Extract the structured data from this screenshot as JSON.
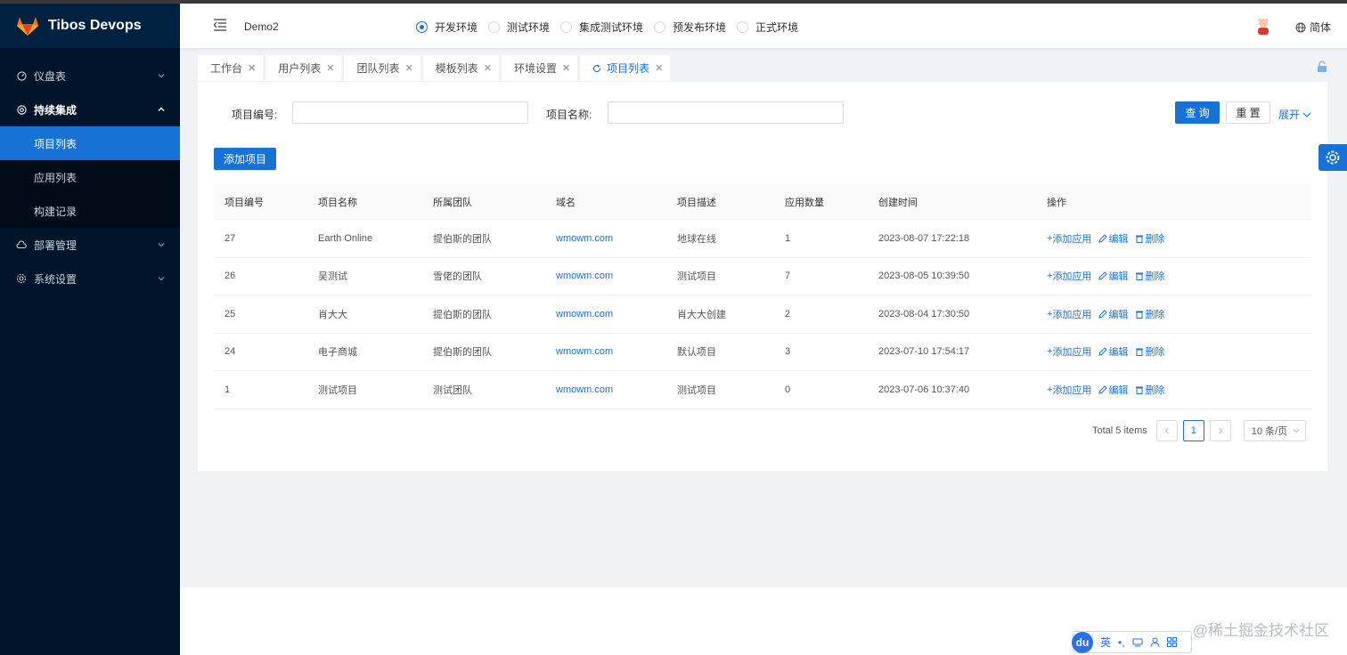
{
  "app": {
    "title": "Tibos Devops"
  },
  "colors": {
    "accent": "#1872d6",
    "sidebar_bg": "#001529"
  },
  "sidebar": {
    "items": [
      {
        "label": "仪盘表",
        "icon": "dashboard-icon"
      },
      {
        "label": "持续集成",
        "icon": "ci-icon",
        "open": true,
        "children": [
          {
            "label": "项目列表",
            "active": true
          },
          {
            "label": "应用列表"
          },
          {
            "label": "构建记录"
          }
        ]
      },
      {
        "label": "部署管理",
        "icon": "cloud-icon"
      },
      {
        "label": "系统设置",
        "icon": "gear-icon"
      }
    ]
  },
  "header": {
    "project": "Demo2",
    "envs": [
      {
        "label": "开发环境",
        "checked": true
      },
      {
        "label": "测试环境"
      },
      {
        "label": "集成测试环境"
      },
      {
        "label": "预发布环境"
      },
      {
        "label": "正式环境"
      }
    ],
    "lang": "简体"
  },
  "tabs": [
    {
      "label": "工作台"
    },
    {
      "label": "用户列表"
    },
    {
      "label": "团队列表"
    },
    {
      "label": "模板列表"
    },
    {
      "label": "环境设置"
    },
    {
      "label": "项目列表",
      "active": true
    }
  ],
  "search": {
    "code_label": "项目编号:",
    "name_label": "项目名称:",
    "query_btn": "查 询",
    "reset_btn": "重 置",
    "expand": "展开"
  },
  "add_button": "添加项目",
  "table": {
    "columns": [
      "项目编号",
      "项目名称",
      "所属团队",
      "域名",
      "项目描述",
      "应用数量",
      "创建时间",
      "操作"
    ],
    "rows": [
      {
        "id": "27",
        "name": "Earth Online",
        "team": "提伯斯的团队",
        "domain": "wmowm.com",
        "desc": "地球在线",
        "apps": "1",
        "created": "2023-08-07 17:22:18"
      },
      {
        "id": "26",
        "name": "吴测试",
        "team": "雪佬的团队",
        "domain": "wmowm.com",
        "desc": "测试项目",
        "apps": "7",
        "created": "2023-08-05 10:39:50"
      },
      {
        "id": "25",
        "name": "肖大大",
        "team": "提伯斯的团队",
        "domain": "wmowm.com",
        "desc": "肖大大创建",
        "apps": "2",
        "created": "2023-08-04 17:30:50"
      },
      {
        "id": "24",
        "name": "电子商城",
        "team": "提伯斯的团队",
        "domain": "wmowm.com",
        "desc": "默认项目",
        "apps": "3",
        "created": "2023-07-10 17:54:17"
      },
      {
        "id": "1",
        "name": "测试项目",
        "team": "测试团队",
        "domain": "wmowm.com",
        "desc": "测试项目",
        "apps": "0",
        "created": "2023-07-06 10:37:40"
      }
    ],
    "ops": {
      "add": "添加应用",
      "edit": "编辑",
      "delete": "删除"
    }
  },
  "pagination": {
    "total": "Total 5 items",
    "page": "1",
    "size": "10 条/页"
  },
  "watermark": "@稀土掘金技术社区",
  "ime": {
    "logo": "du",
    "lang": "英"
  }
}
